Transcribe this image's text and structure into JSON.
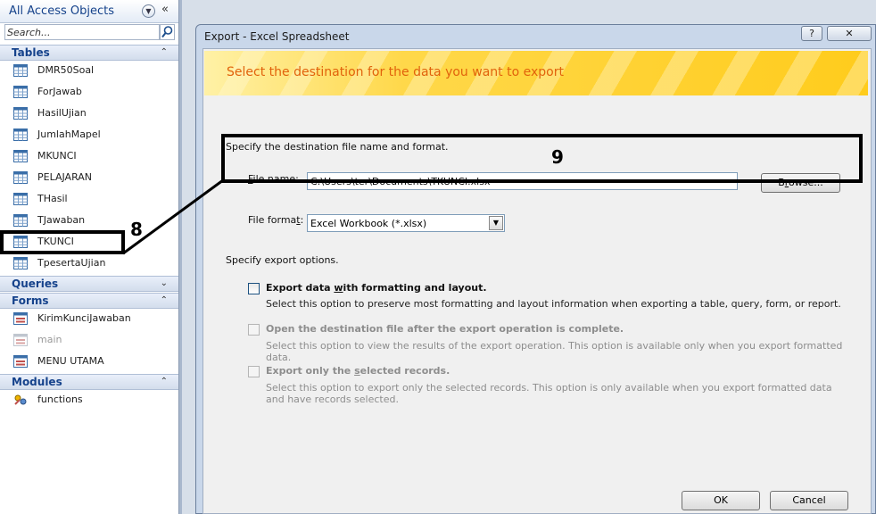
{
  "nav": {
    "title": "All Access Objects",
    "search_placeholder": "Search...",
    "groups": {
      "tables": {
        "label": "Tables",
        "items": [
          "DMR50Soal",
          "ForJawab",
          "HasilUjian",
          "JumlahMapel",
          "MKUNCI",
          "PELAJARAN",
          "THasil",
          "TJawaban",
          "TKUNCI",
          "TpesertaUjian"
        ],
        "selected": "TKUNCI"
      },
      "queries": {
        "label": "Queries"
      },
      "forms": {
        "label": "Forms",
        "items": [
          "KirimKunciJawaban",
          "main",
          "MENU UTAMA"
        ]
      },
      "modules": {
        "label": "Modules",
        "items": [
          "functions"
        ]
      }
    }
  },
  "dialog": {
    "title": "Export - Excel Spreadsheet",
    "help_label": "?",
    "close_label": "✕",
    "banner": "Select the destination for the data you want to export",
    "specify_file": "Specify the destination file name and format.",
    "file_name_label": "File name:",
    "file_name_value": "C:\\Users\\ter\\Documents\\TKUNCI.xlsx",
    "browse_label": "Browse...",
    "file_format_label": "File format:",
    "file_format_value": "Excel Workbook (*.xlsx)",
    "specify_options": "Specify export options.",
    "options": [
      {
        "title": "Export data with formatting and layout.",
        "desc": "Select this option to preserve most formatting and layout information when exporting a table, query, form, or report.",
        "enabled": true,
        "checked": false
      },
      {
        "title": "Open the destination file after the export operation is complete.",
        "desc": "Select this option to view the results of the export operation. This option is available only when you export formatted data.",
        "enabled": false,
        "checked": false
      },
      {
        "title": "Export only the selected records.",
        "desc": "Select this option to export only the selected records. This option is only available when you export formatted data and have records selected.",
        "enabled": false,
        "checked": false
      }
    ],
    "ok_label": "OK",
    "cancel_label": "Cancel"
  },
  "annotations": {
    "callout_8": "8",
    "callout_9": "9"
  },
  "colors": {
    "banner_text": "#e1620c",
    "group_header_text": "#15428b",
    "banner_yellow": "#ffcc1c"
  }
}
